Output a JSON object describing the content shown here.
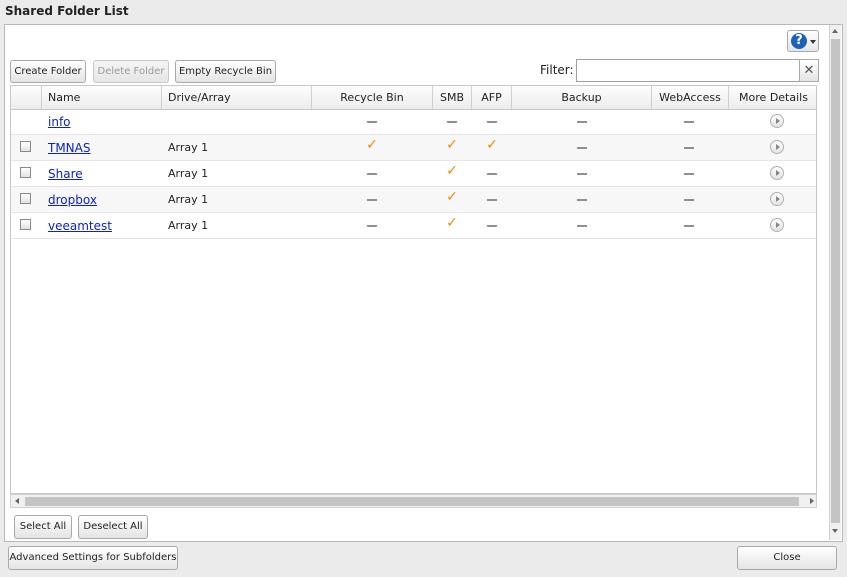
{
  "window": {
    "title": "Shared Folder List"
  },
  "toolbar": {
    "create_folder": "Create Folder",
    "delete_folder": "Delete Folder",
    "empty_recycle_bin": "Empty Recycle Bin",
    "help_symbol": "?"
  },
  "filter": {
    "label": "Filter:",
    "value": "",
    "placeholder": "",
    "clear_symbol": "✕"
  },
  "table": {
    "columns": {
      "name": "Name",
      "drive": "Drive/Array",
      "recycle_bin": "Recycle Bin",
      "smb": "SMB",
      "afp": "AFP",
      "backup": "Backup",
      "webaccess": "WebAccess",
      "more_details": "More Details"
    },
    "rows": [
      {
        "name": "info",
        "drive": "",
        "has_checkbox": false,
        "recycle_bin": false,
        "smb": false,
        "afp": false,
        "backup": false,
        "webaccess": false
      },
      {
        "name": "TMNAS",
        "drive": "Array 1",
        "has_checkbox": true,
        "recycle_bin": true,
        "smb": true,
        "afp": true,
        "backup": false,
        "webaccess": false
      },
      {
        "name": "Share",
        "drive": "Array 1",
        "has_checkbox": true,
        "recycle_bin": false,
        "smb": true,
        "afp": false,
        "backup": false,
        "webaccess": false
      },
      {
        "name": "dropbox",
        "drive": "Array 1",
        "has_checkbox": true,
        "recycle_bin": false,
        "smb": true,
        "afp": false,
        "backup": false,
        "webaccess": false
      },
      {
        "name": "veeamtest",
        "drive": "Array 1",
        "has_checkbox": true,
        "recycle_bin": false,
        "smb": true,
        "afp": false,
        "backup": false,
        "webaccess": false
      }
    ]
  },
  "selection": {
    "select_all": "Select All",
    "deselect_all": "Deselect All"
  },
  "footer": {
    "advanced_settings": "Advanced Settings for Subfolders",
    "close": "Close"
  },
  "icons": {
    "enabled": "check-icon",
    "disabled": "dash-icon",
    "details": "play-circle-icon",
    "help": "question-circle-icon"
  },
  "colors": {
    "check": "#f08a00",
    "link": "#0b22c9",
    "help": "#1d62b8"
  }
}
